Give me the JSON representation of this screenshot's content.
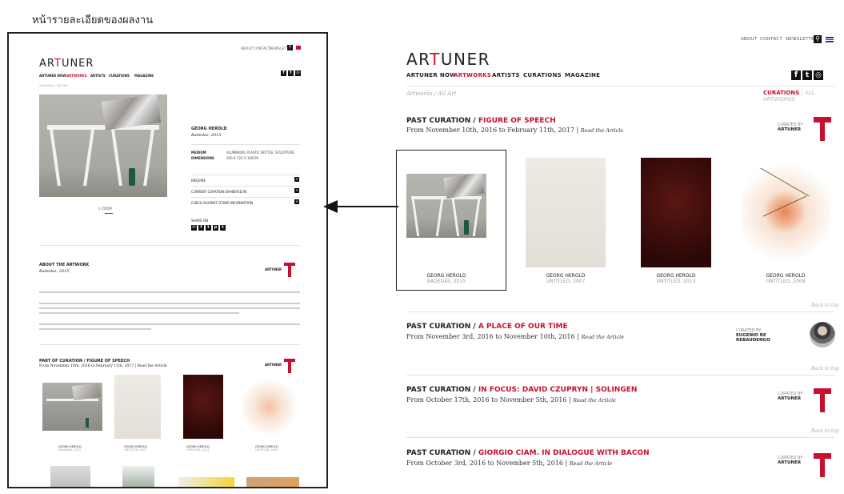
{
  "caption": "หน้ารายละเอียดของผลงาน",
  "top_links": [
    "ABOUT",
    "CONTACT",
    "NEWSLETTER"
  ],
  "logo": {
    "prefix": "AR",
    "t": "T",
    "suffix": "UNER"
  },
  "nav": [
    "ARTUNER NOW",
    "ARTWORKS",
    "ARTISTS",
    "CURATIONS",
    "MAGAZINE"
  ],
  "breadcrumb": "Artworks / All Art",
  "filters": {
    "curations": "CURATIONS",
    "sep": "|",
    "all": "ALL ARTWORKS"
  },
  "detail": {
    "artist": "GEORG HEROLD",
    "title": "Badedas, 2015",
    "medium_label": "MEDIUM",
    "medium_value": "ALUMINIUM, PLASTIC BOTTLE, SCULPTURE",
    "dimensions_label": "DIMENSIONS",
    "dimensions_value": "200 X 123 X 100CM",
    "accordion": [
      "ENQUIRE",
      "CURRENT CURATION EXHIBITED IN",
      "CHECK AGAINST OTHER INFORMATION"
    ],
    "share_label": "SHARE ON",
    "zoom_label": "ZOOM",
    "about_title": "ABOUT THE ARTWORK",
    "about_sub": "Badedas, 2015",
    "curated_by": "ARTUNER",
    "part_of": "PART OF CURATION / FIGURE OF SPEECH",
    "part_dates": "From November 10th, 2016 to February 11th, 2017 | Read the Article"
  },
  "figure_of_speech": {
    "label": "PAST CURATION / ",
    "name": "FIGURE OF SPEECH",
    "dates": "From November 10th, 2016 to February 11th, 2017 |",
    "read": "Read the Article",
    "curated_label": "CURATED BY:",
    "curator": "ARTUNER",
    "works": [
      {
        "artist": "GEORG HEROLD",
        "title": "BADEDAS, 2015"
      },
      {
        "artist": "GEORG HEROLD",
        "title": "UNTITLED, 2007"
      },
      {
        "artist": "GEORG HEROLD",
        "title": "UNTITLED, 2013"
      },
      {
        "artist": "GEORG HEROLD",
        "title": "UNTITLED, 2009"
      }
    ]
  },
  "back_to_top": "Back to top",
  "curations": [
    {
      "label": "PAST CURATION / ",
      "name": "A PLACE OF OUR TIME",
      "dates": "From November 3rd, 2016 to November 10th, 2016 |",
      "read": "Read the Article",
      "curated_label": "CURATED BY:",
      "curator": "EUGENIO RE REBAUDENGO"
    },
    {
      "label": "PAST CURATION / ",
      "name": "IN FOCUS: DAVID CZUPRYN | SOLINGEN",
      "dates": "From October 17th, 2016 to November 5th, 2016 |",
      "read": "Read the Article",
      "curated_label": "CURATED BY:",
      "curator": "ARTUNER"
    },
    {
      "label": "PAST CURATION / ",
      "name": "GIORGIO CIAM. IN DIALOGUE WITH BACON",
      "dates": "From October 3rd, 2016 to November 5th, 2016 |",
      "read": "Read the Article",
      "curated_label": "CURATED BY:",
      "curator": "ARTUNER"
    }
  ],
  "colors": {
    "accent": "#c8102e",
    "text": "#222222",
    "muted": "#999999"
  }
}
